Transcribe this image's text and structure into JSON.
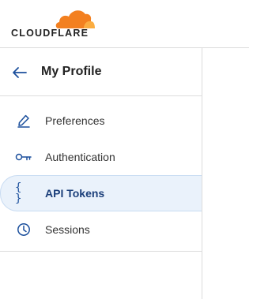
{
  "brand": {
    "wordmark": "CLOUDFLARE",
    "colors": {
      "orange": "#f38020",
      "light_orange": "#fbad41"
    }
  },
  "sidebar": {
    "title": "My Profile",
    "back_icon": "arrow-left-icon",
    "items": [
      {
        "label": "Preferences",
        "icon": "pencil-icon",
        "active": false
      },
      {
        "label": "Authentication",
        "icon": "key-icon",
        "active": false
      },
      {
        "label": "API Tokens",
        "icon": "braces-icon",
        "glyph": "{ }",
        "active": true
      },
      {
        "label": "Sessions",
        "icon": "clock-icon",
        "active": false
      }
    ]
  },
  "colors": {
    "accent": "#1b4f9c",
    "active_bg": "#eaf2fb",
    "border": "#dcdcdc"
  }
}
